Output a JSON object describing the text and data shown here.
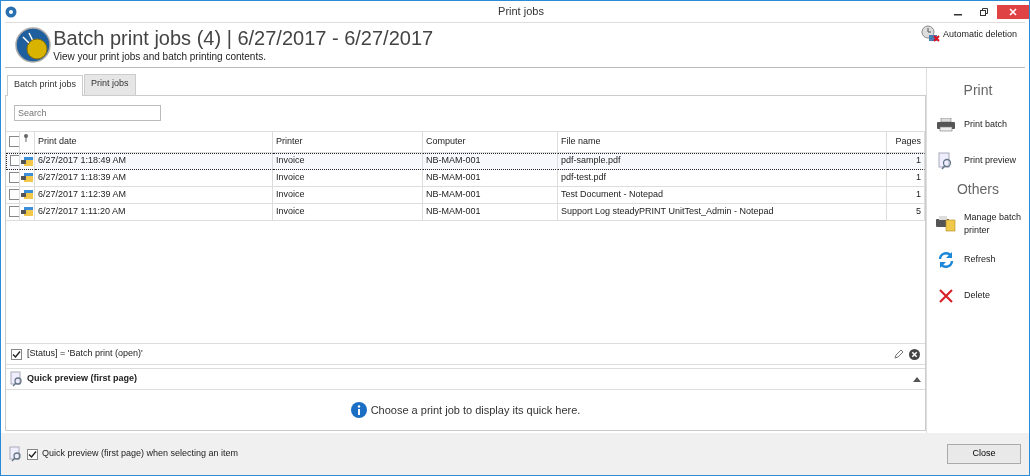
{
  "window": {
    "title": "Print jobs"
  },
  "header": {
    "title": "Batch print jobs (4) | 6/27/2017 - 6/27/2017",
    "subtitle": "View your print jobs and batch printing contents.",
    "action": "Automatic deletion"
  },
  "tabs": [
    {
      "label": "Batch print jobs",
      "selected": true
    },
    {
      "label": "Print jobs",
      "selected": false
    }
  ],
  "search": {
    "placeholder": "Search"
  },
  "table": {
    "select_all": {
      "checked": false
    },
    "columns": [
      "Print date",
      "Printer",
      "Computer",
      "File name",
      "Pages"
    ],
    "rows": [
      {
        "checked": false,
        "focused": true,
        "cells": [
          "6/27/2017 1:18:49 AM",
          "Invoice",
          "NB-MAM-001",
          "pdf-sample.pdf",
          "1"
        ]
      },
      {
        "checked": false,
        "focused": false,
        "cells": [
          "6/27/2017 1:18:39 AM",
          "Invoice",
          "NB-MAM-001",
          "pdf-test.pdf",
          "1"
        ]
      },
      {
        "checked": false,
        "focused": false,
        "cells": [
          "6/27/2017 1:12:39 AM",
          "Invoice",
          "NB-MAM-001",
          "Test Document - Notepad",
          "1"
        ]
      },
      {
        "checked": false,
        "focused": false,
        "cells": [
          "6/27/2017 1:11:20 AM",
          "Invoice",
          "NB-MAM-001",
          "Support Log steadyPRINT UnitTest_Admin - Notepad",
          "5"
        ]
      }
    ]
  },
  "filter": {
    "checked": true,
    "text": "[Status] = 'Batch print (open)'"
  },
  "quick_preview": {
    "title": "Quick preview (first page)",
    "expanded": true,
    "message": "Choose a print job to display its quick here."
  },
  "sidebar": [
    {
      "heading": "Print",
      "items": [
        {
          "kind": "printer",
          "label": "Print batch"
        },
        {
          "kind": "preview",
          "label": "Print preview"
        }
      ]
    },
    {
      "heading": "Others",
      "items": [
        {
          "kind": "manage",
          "label": "Manage batch printer"
        },
        {
          "kind": "refresh",
          "label": "Refresh"
        },
        {
          "kind": "delete",
          "label": "Delete"
        }
      ]
    }
  ],
  "footer": {
    "option": {
      "checked": true,
      "label": "Quick preview (first page) when selecting an item"
    },
    "close_button": "Close"
  }
}
